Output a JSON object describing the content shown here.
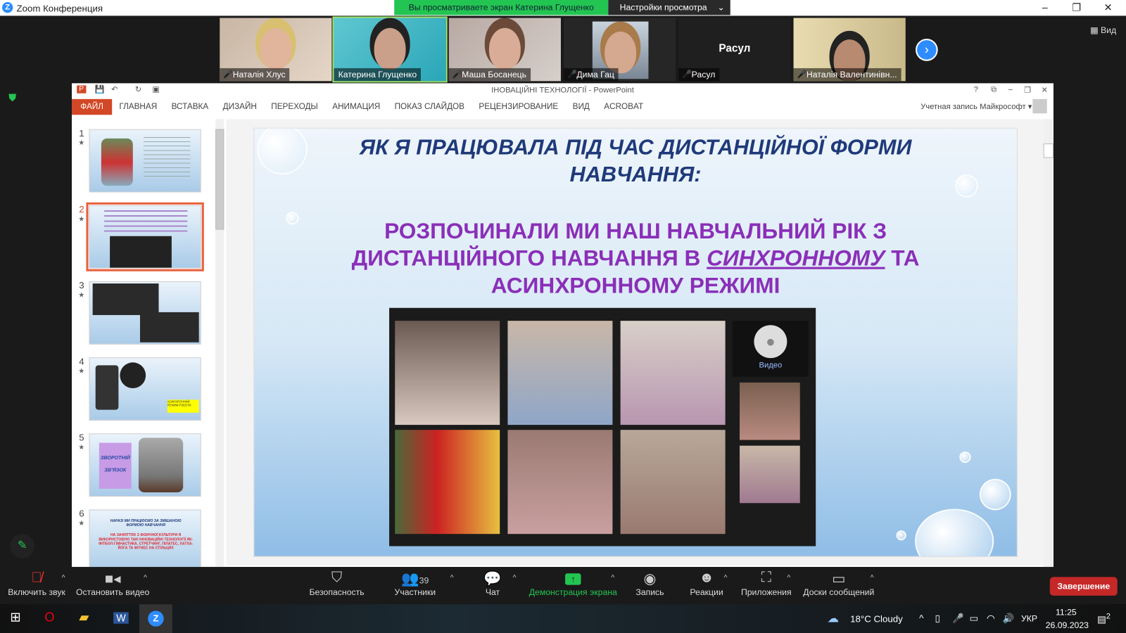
{
  "zoom": {
    "title": "Zoom Конференция",
    "viewing_banner": "Вы просматриваете экран Катерина Глущенко",
    "view_settings": "Настройки просмотра",
    "view_button": "Вид",
    "participants": [
      {
        "name": "Наталія Хлус",
        "muted": true
      },
      {
        "name": "Катерина Глущенко",
        "muted": false
      },
      {
        "name": "Маша Босанець",
        "muted": true
      },
      {
        "name": "Дима Гац",
        "muted": true
      },
      {
        "name": "Расул",
        "muted": true,
        "no_video_label": "Расул"
      },
      {
        "name": "Наталія Валентинівн...",
        "muted": true
      }
    ],
    "toolbar": {
      "unmute": "Включить звук",
      "stop_video": "Остановить видео",
      "security": "Безопасность",
      "participants": "Участники",
      "participants_count": "39",
      "chat": "Чат",
      "share_screen": "Демонстрация экрана",
      "record": "Запись",
      "reactions": "Реакции",
      "apps": "Приложения",
      "whiteboards": "Доски сообщений",
      "end": "Завершение"
    },
    "share_color": "#23c552"
  },
  "ppt": {
    "title": "ІНОВАЦІЙНІ ТЕХНОЛОГІЇ - PowerPoint",
    "account": "Учетная запись Майкрософт",
    "tabs": [
      "ФАЙЛ",
      "ГЛАВНАЯ",
      "ВСТАВКА",
      "ДИЗАЙН",
      "ПЕРЕХОДЫ",
      "АНИМАЦИЯ",
      "ПОКАЗ СЛАЙДОВ",
      "РЕЦЕНЗИРОВАНИЕ",
      "ВИД",
      "ACROBAT"
    ],
    "thumbs": [
      {
        "num": "1"
      },
      {
        "num": "2"
      },
      {
        "num": "3"
      },
      {
        "num": "4",
        "tag": "АСИНХРОННИЙ РЕЖИМ РОБОТИ"
      },
      {
        "num": "5",
        "text1": "ЗВОРОТНІЙ",
        "text2": "ЗВ'ЯЗОК"
      },
      {
        "num": "6",
        "title": "НАРАЗІ МИ ПРАЦЮЄМО ЗА ЗМІШАНОЮ ФОРМОЮ НАВЧАННЯ",
        "body": "НА ЗАНЯТТЯХ З ФІЗИЧНОЇ КУЛЬТУРИ Я ВИКОРИСТОВУЮ ТАКІ ІННОВАЦІЙНІ ТЕХНОЛОГІЇ ЯК: ФІТБОЛ-ГІМНАСТИКА, СТРЕТЧИНГ, ПІЛАТЕС, ХАТХА-ЙОГА ТА ФІТНЕС НА СТІЛЬЦЯХ"
      }
    ],
    "slide": {
      "title_l1": "ЯК Я ПРАЦЮВАЛА ПІД ЧАС ДИСТАНЦІЙНОЇ ФОРМИ",
      "title_l2": "НАВЧАННЯ:",
      "body_l1": "РОЗПОЧИНАЛИ МИ НАШ НАВЧАЛЬНИЙ РІК З",
      "body_l2a": "ДИСТАНЦІЙНОГО НАВЧАННЯ В ",
      "body_l2b": "СИНХРОННОМУ",
      "body_l2c": " ТА",
      "body_l3": "АСИНХРОННОМУ РЕЖИМІ",
      "video_label": "Видео"
    }
  },
  "taskbar": {
    "weather": "18°C  Cloudy",
    "lang": "УКР",
    "time": "11:25",
    "date": "26.09.2023",
    "notif": "2"
  }
}
